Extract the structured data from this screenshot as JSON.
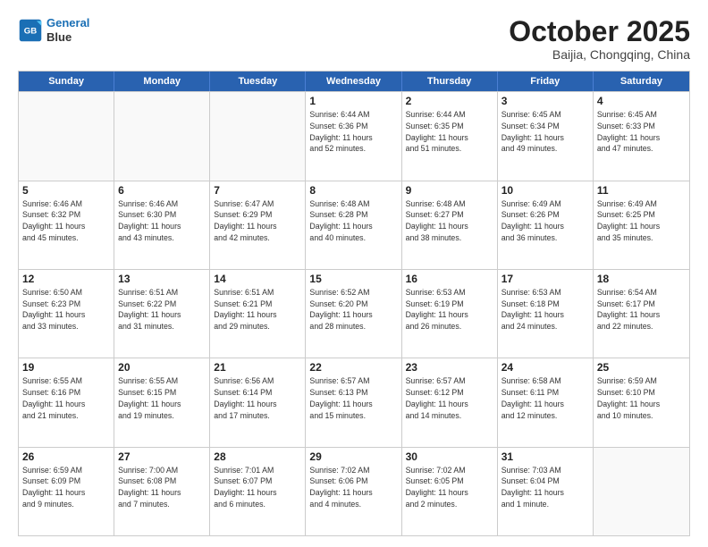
{
  "header": {
    "logo_line1": "General",
    "logo_line2": "Blue",
    "month": "October 2025",
    "location": "Baijia, Chongqing, China"
  },
  "weekdays": [
    "Sunday",
    "Monday",
    "Tuesday",
    "Wednesday",
    "Thursday",
    "Friday",
    "Saturday"
  ],
  "rows": [
    [
      {
        "day": "",
        "info": ""
      },
      {
        "day": "",
        "info": ""
      },
      {
        "day": "",
        "info": ""
      },
      {
        "day": "1",
        "info": "Sunrise: 6:44 AM\nSunset: 6:36 PM\nDaylight: 11 hours\nand 52 minutes."
      },
      {
        "day": "2",
        "info": "Sunrise: 6:44 AM\nSunset: 6:35 PM\nDaylight: 11 hours\nand 51 minutes."
      },
      {
        "day": "3",
        "info": "Sunrise: 6:45 AM\nSunset: 6:34 PM\nDaylight: 11 hours\nand 49 minutes."
      },
      {
        "day": "4",
        "info": "Sunrise: 6:45 AM\nSunset: 6:33 PM\nDaylight: 11 hours\nand 47 minutes."
      }
    ],
    [
      {
        "day": "5",
        "info": "Sunrise: 6:46 AM\nSunset: 6:32 PM\nDaylight: 11 hours\nand 45 minutes."
      },
      {
        "day": "6",
        "info": "Sunrise: 6:46 AM\nSunset: 6:30 PM\nDaylight: 11 hours\nand 43 minutes."
      },
      {
        "day": "7",
        "info": "Sunrise: 6:47 AM\nSunset: 6:29 PM\nDaylight: 11 hours\nand 42 minutes."
      },
      {
        "day": "8",
        "info": "Sunrise: 6:48 AM\nSunset: 6:28 PM\nDaylight: 11 hours\nand 40 minutes."
      },
      {
        "day": "9",
        "info": "Sunrise: 6:48 AM\nSunset: 6:27 PM\nDaylight: 11 hours\nand 38 minutes."
      },
      {
        "day": "10",
        "info": "Sunrise: 6:49 AM\nSunset: 6:26 PM\nDaylight: 11 hours\nand 36 minutes."
      },
      {
        "day": "11",
        "info": "Sunrise: 6:49 AM\nSunset: 6:25 PM\nDaylight: 11 hours\nand 35 minutes."
      }
    ],
    [
      {
        "day": "12",
        "info": "Sunrise: 6:50 AM\nSunset: 6:23 PM\nDaylight: 11 hours\nand 33 minutes."
      },
      {
        "day": "13",
        "info": "Sunrise: 6:51 AM\nSunset: 6:22 PM\nDaylight: 11 hours\nand 31 minutes."
      },
      {
        "day": "14",
        "info": "Sunrise: 6:51 AM\nSunset: 6:21 PM\nDaylight: 11 hours\nand 29 minutes."
      },
      {
        "day": "15",
        "info": "Sunrise: 6:52 AM\nSunset: 6:20 PM\nDaylight: 11 hours\nand 28 minutes."
      },
      {
        "day": "16",
        "info": "Sunrise: 6:53 AM\nSunset: 6:19 PM\nDaylight: 11 hours\nand 26 minutes."
      },
      {
        "day": "17",
        "info": "Sunrise: 6:53 AM\nSunset: 6:18 PM\nDaylight: 11 hours\nand 24 minutes."
      },
      {
        "day": "18",
        "info": "Sunrise: 6:54 AM\nSunset: 6:17 PM\nDaylight: 11 hours\nand 22 minutes."
      }
    ],
    [
      {
        "day": "19",
        "info": "Sunrise: 6:55 AM\nSunset: 6:16 PM\nDaylight: 11 hours\nand 21 minutes."
      },
      {
        "day": "20",
        "info": "Sunrise: 6:55 AM\nSunset: 6:15 PM\nDaylight: 11 hours\nand 19 minutes."
      },
      {
        "day": "21",
        "info": "Sunrise: 6:56 AM\nSunset: 6:14 PM\nDaylight: 11 hours\nand 17 minutes."
      },
      {
        "day": "22",
        "info": "Sunrise: 6:57 AM\nSunset: 6:13 PM\nDaylight: 11 hours\nand 15 minutes."
      },
      {
        "day": "23",
        "info": "Sunrise: 6:57 AM\nSunset: 6:12 PM\nDaylight: 11 hours\nand 14 minutes."
      },
      {
        "day": "24",
        "info": "Sunrise: 6:58 AM\nSunset: 6:11 PM\nDaylight: 11 hours\nand 12 minutes."
      },
      {
        "day": "25",
        "info": "Sunrise: 6:59 AM\nSunset: 6:10 PM\nDaylight: 11 hours\nand 10 minutes."
      }
    ],
    [
      {
        "day": "26",
        "info": "Sunrise: 6:59 AM\nSunset: 6:09 PM\nDaylight: 11 hours\nand 9 minutes."
      },
      {
        "day": "27",
        "info": "Sunrise: 7:00 AM\nSunset: 6:08 PM\nDaylight: 11 hours\nand 7 minutes."
      },
      {
        "day": "28",
        "info": "Sunrise: 7:01 AM\nSunset: 6:07 PM\nDaylight: 11 hours\nand 6 minutes."
      },
      {
        "day": "29",
        "info": "Sunrise: 7:02 AM\nSunset: 6:06 PM\nDaylight: 11 hours\nand 4 minutes."
      },
      {
        "day": "30",
        "info": "Sunrise: 7:02 AM\nSunset: 6:05 PM\nDaylight: 11 hours\nand 2 minutes."
      },
      {
        "day": "31",
        "info": "Sunrise: 7:03 AM\nSunset: 6:04 PM\nDaylight: 11 hours\nand 1 minute."
      },
      {
        "day": "",
        "info": ""
      }
    ]
  ]
}
